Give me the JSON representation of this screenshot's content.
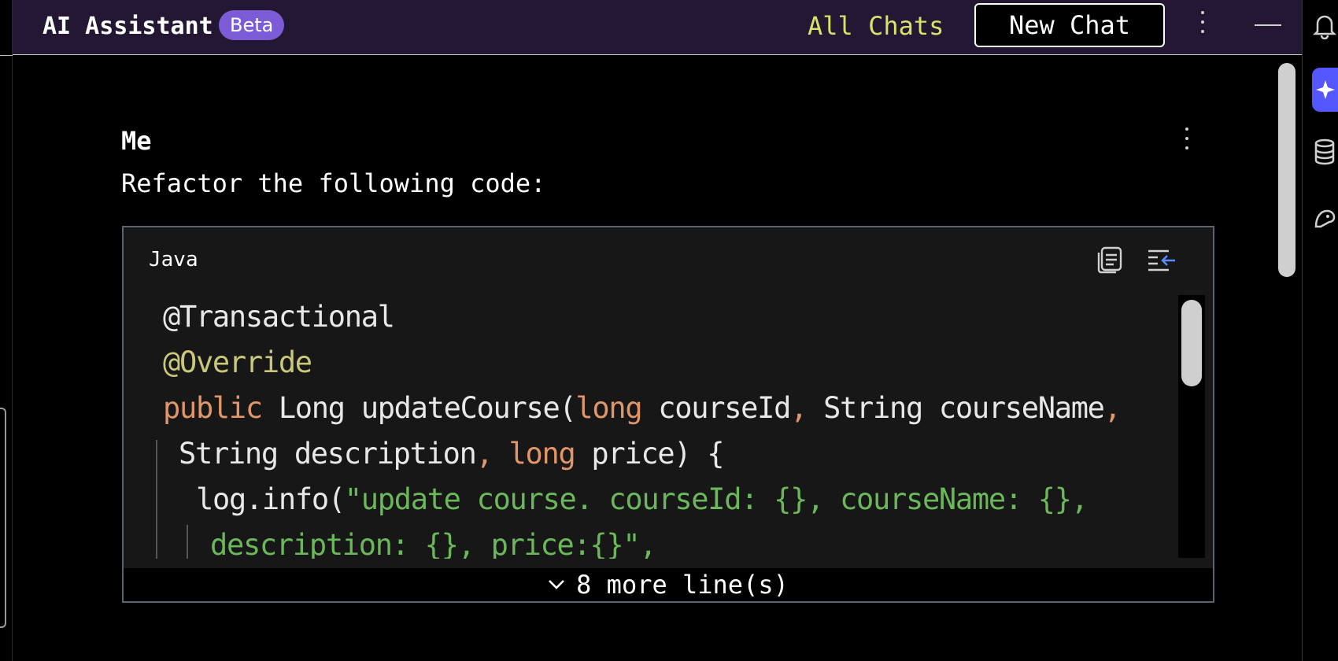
{
  "header": {
    "title": "AI Assistant",
    "badge": "Beta",
    "all_chats": "All Chats",
    "new_chat": "New Chat"
  },
  "message": {
    "author": "Me",
    "text": "Refactor the following code:"
  },
  "code_block": {
    "language": "Java",
    "lines": [
      [
        {
          "t": "@Transactional",
          "c": ""
        }
      ],
      [
        {
          "t": "@Override",
          "c": "ann"
        }
      ],
      [
        {
          "t": "public",
          "c": "kw"
        },
        {
          "t": " Long updateCourse(",
          "c": ""
        },
        {
          "t": "long",
          "c": "kw"
        },
        {
          "t": " courseId",
          "c": ""
        },
        {
          "t": ",",
          "c": "kw"
        },
        {
          "t": " String courseName",
          "c": ""
        },
        {
          "t": ",",
          "c": "kw"
        }
      ],
      [
        {
          "t": "String description",
          "c": ""
        },
        {
          "t": ",",
          "c": "kw"
        },
        {
          "t": " ",
          "c": ""
        },
        {
          "t": "long",
          "c": "kw"
        },
        {
          "t": " price) {",
          "c": ""
        }
      ],
      [
        {
          "t": "log.info(",
          "c": ""
        },
        {
          "t": "\"update course. courseId: {}, courseName: {},",
          "c": "str"
        }
      ],
      [
        {
          "t": "description: {}, price:{}\",",
          "c": "str"
        }
      ]
    ],
    "more_lines": "8 more line(s)"
  },
  "colors": {
    "header_bg": "#241733",
    "badge_bg": "#7b5cd6",
    "all_chats": "#d8e26a",
    "keyword": "#e0956a",
    "annotation": "#c9c77a",
    "string": "#6ab85a",
    "active_tool": "#5457ff"
  },
  "icons": [
    "kebab-icon",
    "minimize-icon",
    "bell-icon",
    "ai-sparkle-icon",
    "database-icon",
    "plugin-icon",
    "copy-icon",
    "insert-at-caret-icon",
    "chevron-down-icon"
  ]
}
